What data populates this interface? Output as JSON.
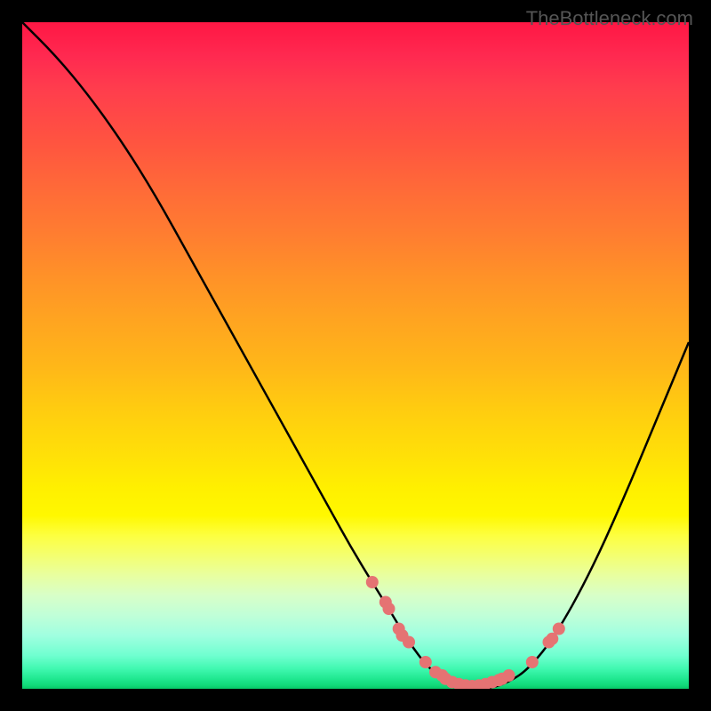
{
  "watermark": "TheBottleneck.com",
  "chart_data": {
    "type": "line",
    "title": "",
    "xlabel": "",
    "ylabel": "",
    "xlim": [
      0,
      100
    ],
    "ylim": [
      0,
      100
    ],
    "curve": {
      "points": [
        {
          "x": 0,
          "y": 100
        },
        {
          "x": 5,
          "y": 95
        },
        {
          "x": 10,
          "y": 89
        },
        {
          "x": 15,
          "y": 82
        },
        {
          "x": 20,
          "y": 74
        },
        {
          "x": 25,
          "y": 65
        },
        {
          "x": 30,
          "y": 56
        },
        {
          "x": 35,
          "y": 47
        },
        {
          "x": 40,
          "y": 38
        },
        {
          "x": 45,
          "y": 29
        },
        {
          "x": 50,
          "y": 20
        },
        {
          "x": 55,
          "y": 12
        },
        {
          "x": 58,
          "y": 7
        },
        {
          "x": 61,
          "y": 3
        },
        {
          "x": 64,
          "y": 1
        },
        {
          "x": 67,
          "y": 0
        },
        {
          "x": 70,
          "y": 0
        },
        {
          "x": 73,
          "y": 1
        },
        {
          "x": 76,
          "y": 3
        },
        {
          "x": 80,
          "y": 8
        },
        {
          "x": 85,
          "y": 17
        },
        {
          "x": 90,
          "y": 28
        },
        {
          "x": 95,
          "y": 40
        },
        {
          "x": 100,
          "y": 52
        }
      ]
    },
    "scatter": {
      "color": "#e57373",
      "points": [
        {
          "x": 52.5,
          "y": 16
        },
        {
          "x": 54.5,
          "y": 13
        },
        {
          "x": 55.0,
          "y": 12
        },
        {
          "x": 56.5,
          "y": 9
        },
        {
          "x": 57.0,
          "y": 8
        },
        {
          "x": 58.0,
          "y": 7
        },
        {
          "x": 60.5,
          "y": 4
        },
        {
          "x": 62.0,
          "y": 2.5
        },
        {
          "x": 63.0,
          "y": 2
        },
        {
          "x": 63.5,
          "y": 1.5
        },
        {
          "x": 64.5,
          "y": 1
        },
        {
          "x": 65.5,
          "y": 0.7
        },
        {
          "x": 66.5,
          "y": 0.5
        },
        {
          "x": 67.5,
          "y": 0.4
        },
        {
          "x": 68.5,
          "y": 0.5
        },
        {
          "x": 69.5,
          "y": 0.7
        },
        {
          "x": 70.5,
          "y": 1
        },
        {
          "x": 71.5,
          "y": 1.3
        },
        {
          "x": 72.0,
          "y": 1.5
        },
        {
          "x": 73.0,
          "y": 2
        },
        {
          "x": 76.5,
          "y": 4
        },
        {
          "x": 79.0,
          "y": 7
        },
        {
          "x": 79.5,
          "y": 7.5
        },
        {
          "x": 80.5,
          "y": 9
        }
      ]
    }
  }
}
